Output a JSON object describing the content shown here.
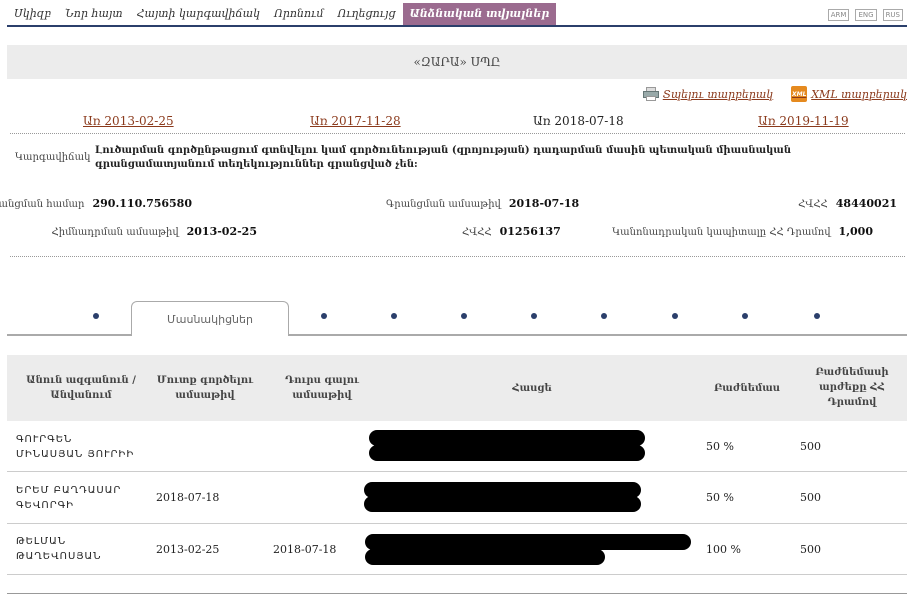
{
  "nav": {
    "items": [
      "Սկիզբ",
      "Նոր հայտ",
      "Հայտի կարգավիճակ",
      "Որոնում",
      "Ուղեցույց",
      "Անձնական տվյալներ"
    ],
    "active_index": 5,
    "languages": [
      "ARM",
      "ENG",
      "RUS"
    ]
  },
  "company": {
    "name": "«ԶԱՐԱ» ՍՊԸ"
  },
  "downloads": {
    "print_label": "Տպելու տարբերակ",
    "xml_label": "XML տարբերակ"
  },
  "dates": [
    "Առ 2013-02-25",
    "Առ 2017-11-28",
    "Առ 2018-07-18",
    "Առ 2019-11-19"
  ],
  "current_date_index": 2,
  "activity": {
    "label": "Կարգավիճակ",
    "value": "Լուծարման գործընթացում գտնվելու կամ գործունեության (զրոյության) դադարման մասին պետական միասնական գրանցամատյանում տեղեկություններ գրանցված չեն:"
  },
  "info": {
    "reg_number_label": "Գրանցման համար",
    "reg_number": "290.110.756580",
    "reg_date_label": "Գրանցման ամսաթիվ",
    "reg_date": "2018-07-18",
    "tax_id_label": "ՀՎՀՀ",
    "tax_id": "48440021",
    "founding_date_label": "Հիմնադրման ամսաթիվ",
    "founding_date": "2013-02-25",
    "code_label": "ՀՎՀՀ",
    "code": "01256137",
    "capital_label": "Կանոնադրական կապիտալը ՀՀ Դրամով",
    "capital": "1,000"
  },
  "tabs": {
    "active_label": "Մասնակիցներ"
  },
  "table": {
    "headers": [
      "Անուն ազգանուն / Անվանում",
      "Մուտք գործելու ամսաթիվ",
      "Դուրս գալու ամսաթիվ",
      "Հասցե",
      "Բաժնեմաս",
      "Բաժնեմասի արժեքը ՀՀ Դրամով"
    ],
    "rows": [
      {
        "name_line1": "ԳՈՒՐԳԵՆ",
        "name_line2": "ՄԻՆԱՍՅԱՆ ՅՈՒՐԻԻ",
        "entry": "",
        "exit": "",
        "share": "50 %",
        "value": "500"
      },
      {
        "name_line1": "ԵՐԵՄ ԲԱՂԴԱՍԱՐ",
        "name_line2": "ԳԵՎՈՐԳԻ",
        "entry": "2018-07-18",
        "exit": "",
        "share": "50 %",
        "value": "500"
      },
      {
        "name_line1": "ԹԵԼՄԱՆ",
        "name_line2": "ԹԱՂԵՎՈՍՅԱՆ",
        "entry": "2013-02-25",
        "exit": "2018-07-18",
        "share": "100 %",
        "value": "500"
      }
    ]
  },
  "colors": {
    "nav_active": "#9b6b8f",
    "link": "#8b3a1c",
    "accent_line": "#2b3f6b",
    "header_bg": "#ececec"
  }
}
